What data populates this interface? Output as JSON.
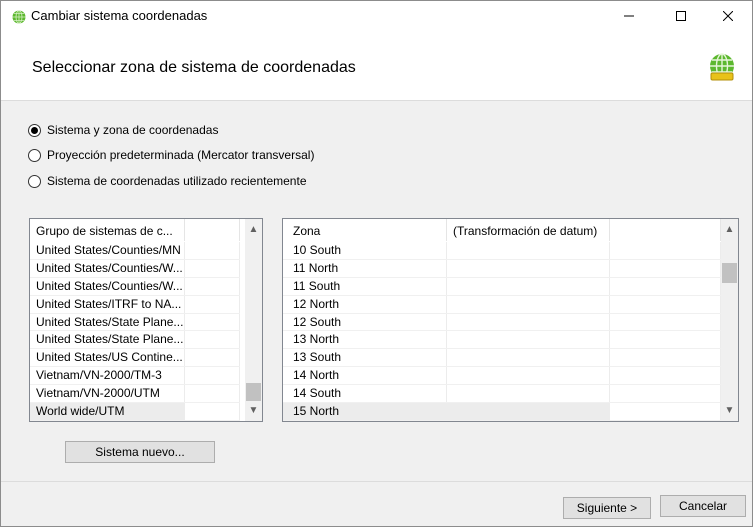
{
  "window": {
    "title": "Cambiar sistema coordenadas",
    "header_title": "Seleccionar zona de sistema de coordenadas"
  },
  "options": [
    {
      "label": "Sistema y zona de coordenadas",
      "selected": true
    },
    {
      "label": "Proyección predeterminada (Mercator transversal)",
      "selected": false
    },
    {
      "label": "Sistema de coordenadas utilizado recientemente",
      "selected": false
    }
  ],
  "group_list": {
    "header": "Grupo de sistemas de c...",
    "items": [
      "United States/Counties/MN",
      "United States/Counties/W...",
      "United States/Counties/W...",
      "United States/ITRF to NA...",
      "United States/State Plane...",
      "United States/State Plane...",
      "United States/US Contine...",
      "Vietnam/VN-2000/TM-3",
      "Vietnam/VN-2000/UTM",
      "World wide/UTM"
    ],
    "selected_index": 9
  },
  "zone_list": {
    "headers": [
      "Zona",
      "(Transformación de datum)"
    ],
    "items": [
      "10 South",
      "11 North",
      "11 South",
      "12 North",
      "12 South",
      "13 North",
      "13 South",
      "14 North",
      "14 South",
      "15 North"
    ],
    "selected_index": 9
  },
  "buttons": {
    "new_system": "Sistema nuevo...",
    "next": "Siguiente >",
    "cancel": "Cancelar"
  },
  "icons": {
    "title": "globe-icon",
    "header": "globe-icon"
  },
  "colors": {
    "globe_green": "#5cb82e",
    "globe_yellow": "#e8c21a"
  }
}
